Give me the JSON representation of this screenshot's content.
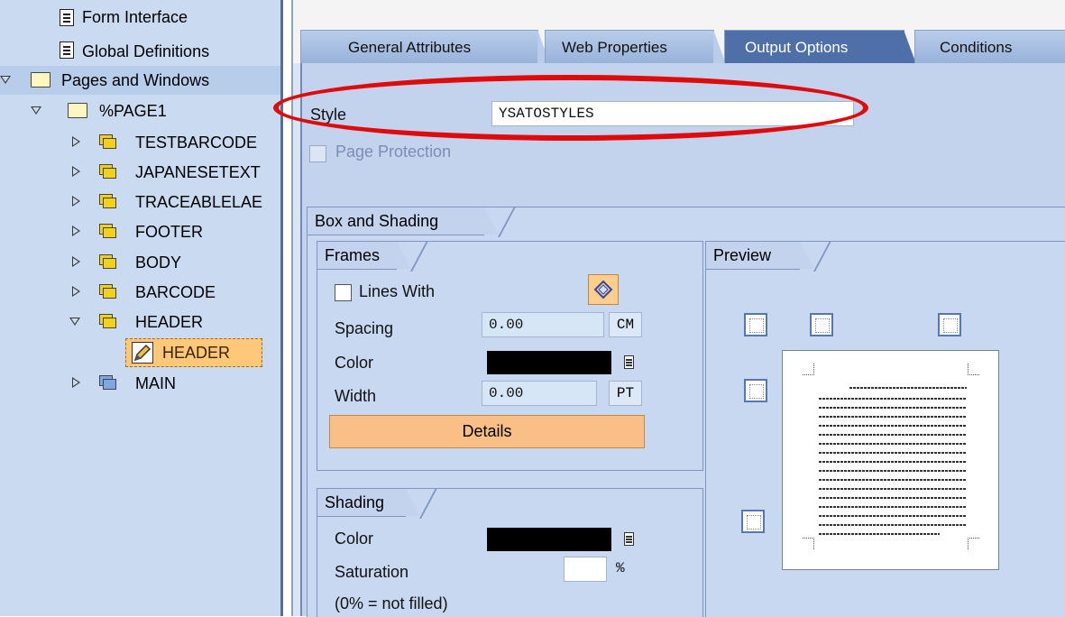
{
  "tree": {
    "items": [
      {
        "label": "Form Interface",
        "icon": "document-icon"
      },
      {
        "label": "Global Definitions",
        "icon": "document-icon"
      },
      {
        "label": "Pages and Windows",
        "icon": "folder-icon"
      },
      {
        "label": "%PAGE1",
        "icon": "folder-icon"
      },
      {
        "label": "TESTBARCODE",
        "icon": "window-icon"
      },
      {
        "label": "JAPANESETEXT",
        "icon": "window-icon"
      },
      {
        "label": "TRACEABLELAE",
        "icon": "window-icon"
      },
      {
        "label": "FOOTER",
        "icon": "window-icon"
      },
      {
        "label": "BODY",
        "icon": "window-icon"
      },
      {
        "label": "BARCODE",
        "icon": "window-icon"
      },
      {
        "label": "HEADER",
        "icon": "window-icon"
      },
      {
        "label": "HEADER",
        "icon": "text-node-icon"
      },
      {
        "label": "MAIN",
        "icon": "main-window-icon"
      }
    ]
  },
  "tabs": [
    "General Attributes",
    "Web Properties",
    "Output Options",
    "Conditions"
  ],
  "active_tab": "Output Options",
  "style": {
    "label": "Style",
    "value": "YSATOSTYLES"
  },
  "page_protection": {
    "label": "Page Protection",
    "checked": false,
    "disabled": true
  },
  "box_and_shading": {
    "title": "Box and Shading",
    "frames": {
      "title": "Frames",
      "lines_with": {
        "label": "Lines With",
        "checked": false
      },
      "spacing": {
        "label": "Spacing",
        "value": "0.00",
        "unit": "CM"
      },
      "color": {
        "label": "Color",
        "value": "#000000"
      },
      "width": {
        "label": "Width",
        "value": "0.00",
        "unit": "PT"
      },
      "details_label": "Details"
    },
    "shading": {
      "title": "Shading",
      "color": {
        "label": "Color",
        "value": "#000000"
      },
      "saturation": {
        "label": "Saturation",
        "value": "",
        "unit": "%"
      },
      "note": "(0% = not filled)"
    },
    "preview": {
      "title": "Preview"
    }
  },
  "colors": {
    "highlight_oval": "#e10a0a",
    "active_tab": "#4e6fa8",
    "details_button": "#f9bf86"
  }
}
